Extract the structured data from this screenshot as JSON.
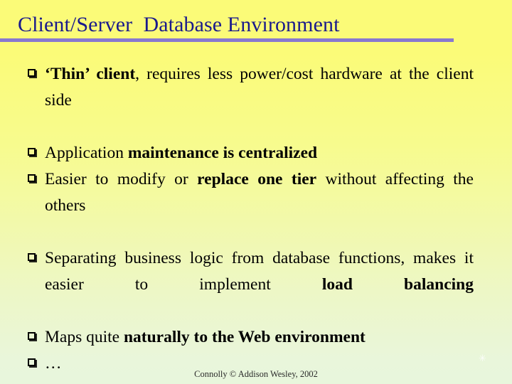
{
  "slide": {
    "title": "Client/Server  Database Environment",
    "title_color": "#1a1a8c",
    "rule_color": "#8878d0",
    "background_top_color": "#fbfb78",
    "background_bottom_color": "#e8f6dc",
    "text_color": "#000000",
    "bullet_glyph": "hollow-square"
  },
  "bullets": [
    {
      "id": "thin-client",
      "segments": [
        {
          "text": "‘Thin’ client",
          "bold": true
        },
        {
          "text": ", requires less power/cost hardware at the client side",
          "bold": false
        }
      ],
      "justified": true
    },
    {
      "id": "application-maintenance",
      "segments": [
        {
          "text": "Application ",
          "bold": false
        },
        {
          "text": "maintenance is centralized",
          "bold": true
        }
      ],
      "justified": false
    },
    {
      "id": "easier-to-modify",
      "segments": [
        {
          "text": "Easier to modify or ",
          "bold": false
        },
        {
          "text": "replace one tier",
          "bold": true
        },
        {
          "text": " without affecting the others",
          "bold": false
        }
      ],
      "justified": true
    },
    {
      "id": "separating-business-logic",
      "segments": [
        {
          "text": "Separating business logic from database functions, makes it easier to implement ",
          "bold": false
        },
        {
          "text": "load balancing",
          "bold": true
        }
      ],
      "justified": true
    },
    {
      "id": "maps-to-web",
      "segments": [
        {
          "text": "Maps quite ",
          "bold": false
        },
        {
          "text": "naturally to the Web environment",
          "bold": true
        }
      ],
      "justified": false
    },
    {
      "id": "ellipsis",
      "segments": [
        {
          "text": "…",
          "bold": false
        }
      ],
      "justified": false
    }
  ],
  "footer": {
    "credit": "Connolly © Addison Wesley, 2002"
  },
  "corner_mark": {
    "glyph": "✳"
  }
}
